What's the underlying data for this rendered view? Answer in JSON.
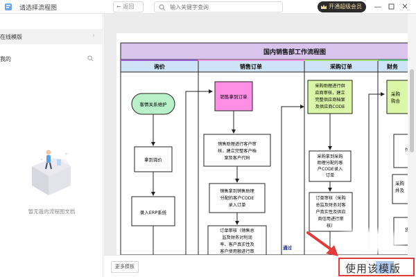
{
  "window": {
    "title": "请选择流程图",
    "back_label": "返回",
    "search_placeholder": "输入关键字查询",
    "vip_label": "开通超级会员"
  },
  "sidebar": {
    "online_label": "在线模版",
    "mine_label": "我的",
    "empty_text": "暂无我的流程图文档"
  },
  "diagram": {
    "title": "国内销售部工作流程图",
    "lanes": [
      "询价",
      "销售订单",
      "采购订单",
      "财务"
    ],
    "nodes": {
      "customer_maint": "客情关系维护",
      "get_inquiry": "拿到询价",
      "enter_erp": "录入ERP系统",
      "sales_get_order": "销售拿到订单",
      "sales_asst_review": [
        "销售助理进行客户审",
        "核，建立完整客户档",
        "案及客户代码"
      ],
      "sales_to_asst": [
        "销售拿到销售助理",
        "分配的客户CODE",
        "录入订单"
      ],
      "order_review_sales": [
        "订单审核（销售总",
        "监及财务对利润",
        "率、客户真实性及",
        "客户使用额进行审"
      ],
      "purchase_asst_review": [
        "采购助理进行供",
        "应商审核，建立",
        "完整供应商档案",
        "及供应商CODE"
      ],
      "purchase_get_asst": [
        "采购拿到采购",
        "助理分配的客",
        "户CODE录入",
        "订单"
      ],
      "order_review_purchase": [
        "订单审核（采购",
        "总监及财务对客",
        "户真实性及供应",
        "商信用进行审",
        "核）"
      ],
      "pass_label": "通过",
      "finance_partial_1": [
        "采购",
        "购合"
      ],
      "finance_partial_2": "付",
      "finance_partial_3": [
        "采购",
        "并及"
      ],
      "finance_partial_4": "货"
    }
  },
  "bottom": {
    "more_label": "更多模板",
    "use_label": "使用该模版"
  },
  "colors": {
    "title_band": "#d9c4ee",
    "lane_header": "#cfe3f7",
    "lane1_border": "#9b59d0",
    "lane2_border": "#ff8ed8",
    "lane3_border": "#a4dd6a",
    "lane4_border": "#5ad07d",
    "terminator_fill": "#b8f0c8",
    "pink_fill": "#ff8fe4",
    "green_fill": "#d9f7a6",
    "highlight_red": "#e23b3b"
  }
}
